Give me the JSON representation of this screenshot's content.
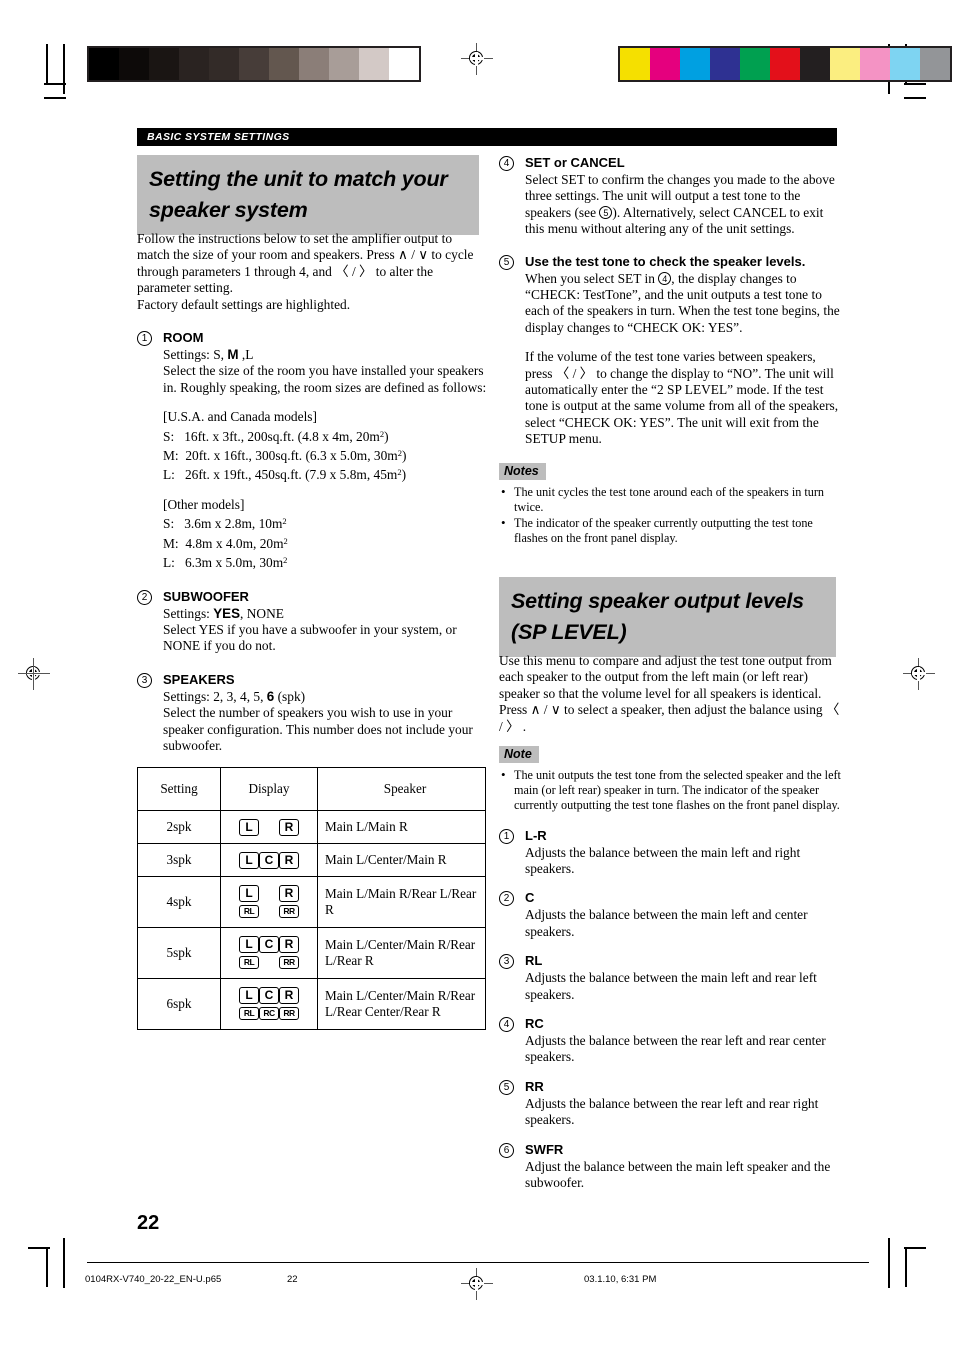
{
  "section_tag": "BASIC SYSTEM SETTINGS",
  "headings": {
    "left": "Setting the unit to match your speaker system",
    "left_line1": "Setting the unit to match your",
    "left_line2": "speaker system",
    "right_line1": "Setting speaker output levels",
    "right_line2": "(SP LEVEL)"
  },
  "intro": {
    "p1": "Follow the instructions below to set the amplifier output to match the size of your room and speakers. Press ∧ / ∨ to cycle through parameters 1 through 4, and 〈 / 〉 to alter the parameter setting.",
    "p2": "Factory default settings are highlighted."
  },
  "left_items": [
    {
      "num": "1",
      "title": "ROOM",
      "settings_prefix": "Settings: S, ",
      "settings_bold": "M",
      "settings_suffix": " ,L",
      "body": "Select the size of the room you have installed your speakers in. Roughly speaking, the room sizes are defined as follows:",
      "block1_title": "[U.S.A. and Canada models]",
      "block1_lines": [
        "S:   16ft. x 3ft., 200sq.ft. (4.8 x 4m, 20m²)",
        "M:  20ft. x 16ft., 300sq.ft. (6.3 x 5.0m, 30m²)",
        "L:   26ft. x 19ft., 450sq.ft. (7.9 x 5.8m, 45m²)"
      ],
      "block2_title": "[Other models]",
      "block2_lines": [
        "S:   3.6m x 2.8m, 10m²",
        "M:  4.8m x 4.0m, 20m²",
        "L:   6.3m x 5.0m, 30m²"
      ]
    },
    {
      "num": "2",
      "title": "SUBWOOFER",
      "settings_prefix": "Settings: ",
      "settings_bold": "YES",
      "settings_suffix": ", NONE",
      "body": "Select YES if you have a subwoofer in your system, or NONE if you do not."
    },
    {
      "num": "3",
      "title": "SPEAKERS",
      "settings_prefix": "Settings: 2, 3, 4, 5, ",
      "settings_bold": "6",
      "settings_suffix": " (spk)",
      "body": "Select the number of speakers you wish to use in your speaker configuration. This number does not include your subwoofer."
    }
  ],
  "table": {
    "headers": [
      "Setting",
      "Display",
      "Speaker"
    ],
    "rows": [
      {
        "setting": "2spk",
        "display_top": [
          "L",
          "",
          "R"
        ],
        "display_bottom": [],
        "speaker": "Main L/Main R"
      },
      {
        "setting": "3spk",
        "display_top": [
          "L",
          "C",
          "R"
        ],
        "display_bottom": [],
        "speaker": "Main L/Center/Main R"
      },
      {
        "setting": "4spk",
        "display_top": [
          "L",
          "",
          "R"
        ],
        "display_bottom": [
          "RL",
          "",
          "RR"
        ],
        "speaker": "Main L/Main R/Rear L/Rear R"
      },
      {
        "setting": "5spk",
        "display_top": [
          "L",
          "C",
          "R"
        ],
        "display_bottom": [
          "RL",
          "",
          "RR"
        ],
        "speaker": "Main L/Center/Main R/Rear L/Rear R"
      },
      {
        "setting": "6spk",
        "display_top": [
          "L",
          "C",
          "R"
        ],
        "display_bottom": [
          "RL",
          "RC",
          "RR"
        ],
        "speaker": "Main L/Center/Main R/Rear L/Rear Center/Rear R"
      }
    ]
  },
  "right_items": [
    {
      "num": "4",
      "title": "SET or CANCEL",
      "body_a": "Select SET to confirm the changes you made to the above three settings. The unit will output a test tone to the speakers (see ",
      "body_ref": "5",
      "body_b": "). Alternatively, select CANCEL to exit this menu without altering any of the unit settings."
    },
    {
      "num": "5",
      "title": "Use the test tone to check the speaker levels.",
      "body_a": "When you select SET in ",
      "body_ref": "4",
      "body_b": ", the display changes to “CHECK: TestTone”, and the unit outputs a test tone to each of the speakers in turn. When the test tone begins, the display changes to “CHECK OK: YES”.",
      "body_c": "If the volume of the test tone varies between speakers, press 〈 / 〉 to change the display to “NO”. The unit will automatically enter the “2 SP LEVEL” mode. If the test tone is output at the same volume from all of the speakers, select “CHECK OK: YES”. The unit will exit from the SETUP menu."
    }
  ],
  "notes_block": {
    "tag": "Notes",
    "items": [
      "The unit cycles the test tone around each of the speakers in turn twice.",
      "The indicator of the speaker currently outputting the test tone flashes on the front panel display."
    ]
  },
  "sp_level": {
    "body": "Use this menu to compare and adjust the test tone output from each speaker to the output from the left main (or left rear) speaker so that the volume level for all speakers is identical. Press ∧ / ∨ to select a speaker, then adjust the balance using 〈 / 〉 .",
    "note_tag": "Note",
    "note_items": [
      "The unit outputs the test tone from the selected speaker and the left main (or left rear) speaker in turn. The indicator of the speaker currently outputting the test tone flashes on the front panel display."
    ],
    "items": [
      {
        "num": "1",
        "title": "L-R",
        "body": "Adjusts the balance between the main left and right speakers."
      },
      {
        "num": "2",
        "title": "C",
        "body": "Adjusts the balance between the main left and center speakers."
      },
      {
        "num": "3",
        "title": "RL",
        "body": "Adjusts the balance between the main left and rear left speakers."
      },
      {
        "num": "4",
        "title": "RC",
        "body": "Adjusts the balance between the rear left and rear center speakers."
      },
      {
        "num": "5",
        "title": "RR",
        "body": "Adjusts the balance between the rear left and rear right speakers."
      },
      {
        "num": "6",
        "title": "SWFR",
        "body": "Adjust the balance between the main left speaker and the subwoofer."
      }
    ]
  },
  "page_number": "22",
  "footer": {
    "filename": "0104RX-V740_20-22_EN-U.p65",
    "page": "22",
    "timestamp": "03.1.10, 6:31 PM"
  },
  "calibration": {
    "gray_wedge": [
      "#000000",
      "#0d0a09",
      "#1a1513",
      "#2a2321",
      "#332b28",
      "#473d39",
      "#63574f",
      "#8b7e78",
      "#a89d98",
      "#d3c9c6",
      "#ffffff"
    ],
    "color_bar": [
      "#f5e000",
      "#e5007e",
      "#00a0e1",
      "#2e3192",
      "#00a050",
      "#e3101a",
      "#231f20",
      "#fbee80",
      "#f493c4",
      "#7ed4f2",
      "#939598"
    ]
  }
}
